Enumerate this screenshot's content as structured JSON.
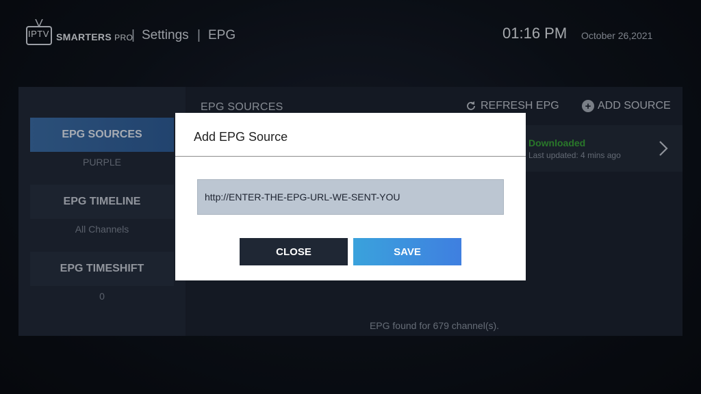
{
  "header": {
    "logo_iptv": "IPTV",
    "logo_brand": "SMARTERS",
    "logo_pro": "PRO",
    "crumbs": [
      "Settings",
      "EPG"
    ],
    "time": "01:16 PM",
    "date": "October 26,2021"
  },
  "sidebar": {
    "items": [
      {
        "label": "EPG SOURCES",
        "sub": "PURPLE"
      },
      {
        "label": "EPG TIMELINE",
        "sub": "All Channels"
      },
      {
        "label": "EPG TIMESHIFT",
        "sub": "0"
      }
    ]
  },
  "main": {
    "title": "EPG SOURCES",
    "refresh_label": "REFRESH EPG",
    "add_label": "ADD SOURCE",
    "source_status": "Downloaded",
    "source_updated": "Last updated: 4 mins ago",
    "footer": "EPG found for 679 channel(s)."
  },
  "dialog": {
    "title": "Add EPG Source",
    "input_value": "http://ENTER-THE-EPG-URL-WE-SENT-YOU",
    "close_label": "CLOSE",
    "save_label": "SAVE"
  },
  "colors": {
    "accent": "#3c6ea8",
    "status_green": "#3aa53a",
    "save_gradient_start": "#3aa2dc",
    "save_gradient_end": "#3f7fe0"
  }
}
